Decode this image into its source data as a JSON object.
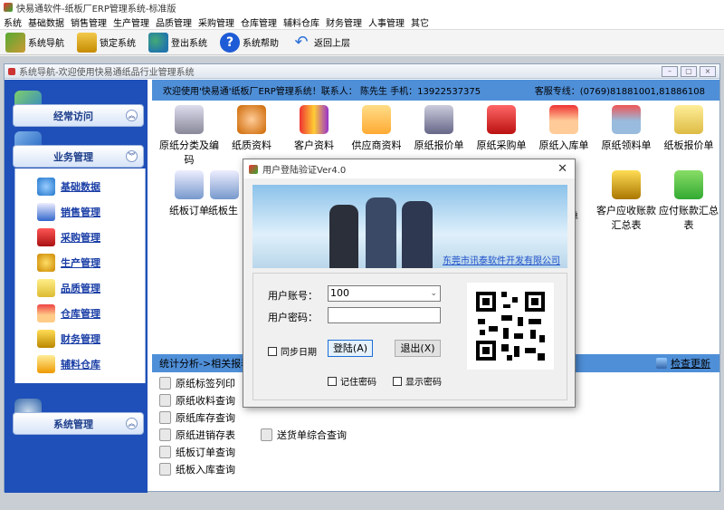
{
  "window": {
    "title": "快易通软件-纸板厂ERP管理系统-标准版"
  },
  "menu": [
    "系统",
    "基础数据",
    "销售管理",
    "生产管理",
    "品质管理",
    "采购管理",
    "仓库管理",
    "辅料仓库",
    "财务管理",
    "人事管理",
    "其它"
  ],
  "toolbar": {
    "items": [
      "系统导航",
      "锁定系统",
      "登出系统",
      "系统帮助",
      "返回上层"
    ]
  },
  "child_window": {
    "title": "系统导航-欢迎使用快易通纸品行业管理系统"
  },
  "sidebar": {
    "groups": [
      "经常访问",
      "业务管理",
      "系统管理"
    ],
    "business_items": [
      "基础数据",
      "销售管理",
      "采购管理",
      "生产管理",
      "品质管理",
      "仓库管理",
      "财务管理",
      "辅料仓库"
    ]
  },
  "banner": {
    "welcome": "欢迎使用'快易通'纸板厂ERP管理系统！联系人：  陈先生  手机：13922537375",
    "hotline": "客服专线：(0769)81881001,81886108"
  },
  "modules": {
    "row1": [
      "原纸分类及编码",
      "纸质资料",
      "客户资料",
      "供应商资料",
      "原纸报价单",
      "原纸采购单",
      "原纸入库单",
      "原纸领料单",
      "纸板报价单"
    ],
    "row2": [
      "纸板订单",
      "纸板生",
      "客户应收账款汇总表",
      "应付账款汇总表"
    ],
    "row2_hidden_tail": "单"
  },
  "stat_bar": {
    "label": "统计分析->相关报表",
    "update": "检查更新"
  },
  "reports": {
    "col1": [
      "原纸标签列印",
      "原纸收料查询",
      "原纸库存查询",
      "原纸进销存表",
      "纸板订单查询",
      "纸板入库查询"
    ],
    "col2": [
      "送货单综合查询"
    ]
  },
  "dialog": {
    "title": "用户登陆验证Ver4.0",
    "company": "东莞市讯泰软件开发有限公司",
    "account_label": "用户账号：",
    "account_value": "100",
    "password_label": "用户密码：",
    "sync_label": "同步日期",
    "login_btn": "登陆(A)",
    "exit_btn": "退出(X)",
    "remember_label": "记住密码",
    "show_pwd_label": "显示密码"
  },
  "colors": {
    "sidebar": "#1f4fb8",
    "banner": "#4f8fd8",
    "accent": "#1d4fc9"
  }
}
